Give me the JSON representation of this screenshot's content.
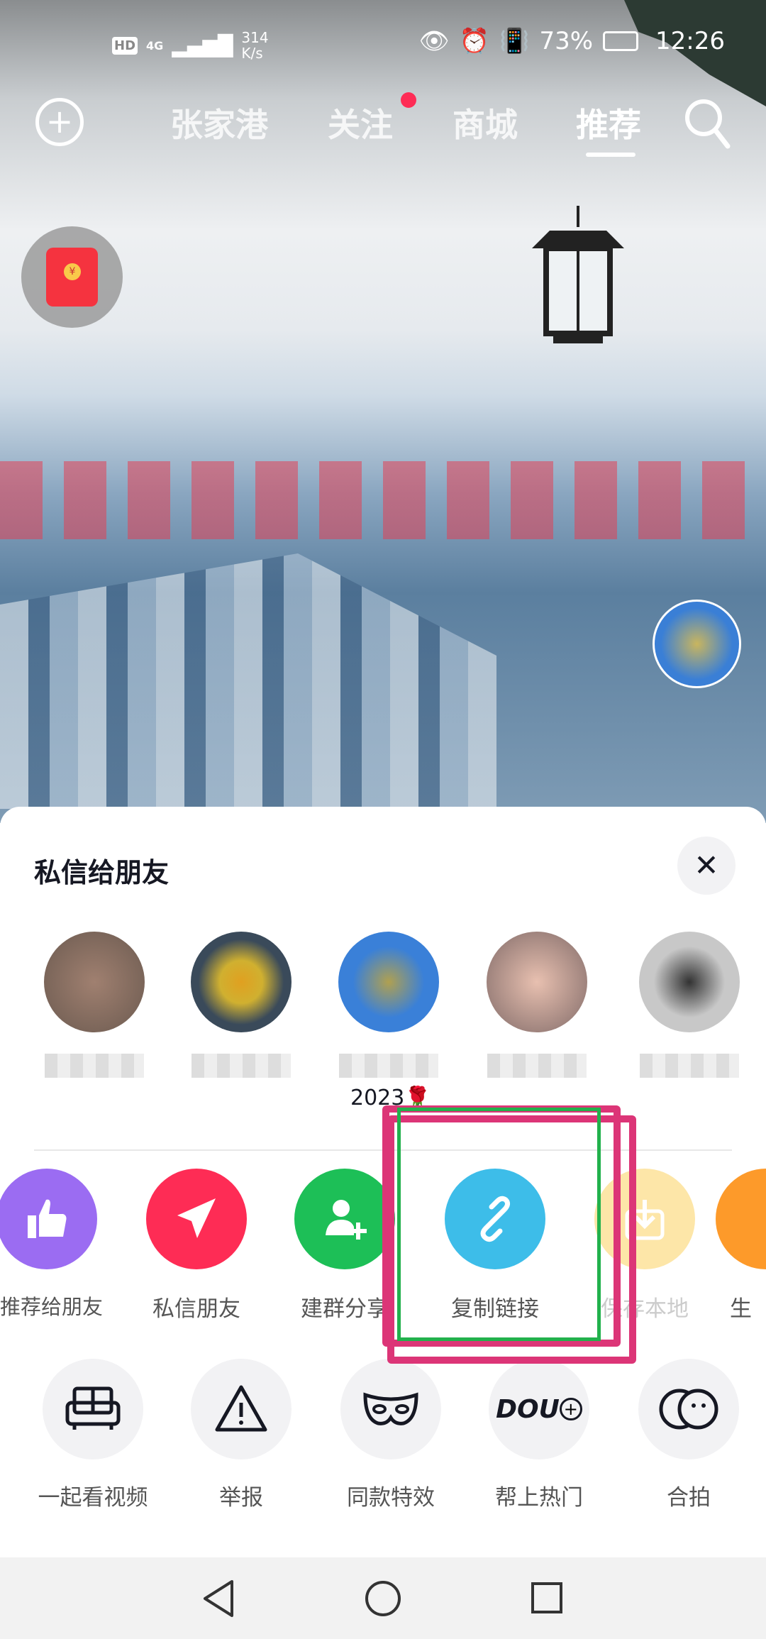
{
  "status_bar": {
    "hd": "HD",
    "network": "4G",
    "speed_value": "314",
    "speed_unit": "K/s",
    "battery": "73%",
    "time": "12:26"
  },
  "top_nav": {
    "tabs": [
      {
        "label": "张家港"
      },
      {
        "label": "关注",
        "badge": true
      },
      {
        "label": "商城"
      },
      {
        "label": "推荐",
        "active": true
      }
    ]
  },
  "share_sheet": {
    "title": "私信给朋友",
    "friends": [
      {
        "name": ""
      },
      {
        "name": ""
      },
      {
        "name": "",
        "extra": "2023🌹"
      },
      {
        "name": ""
      },
      {
        "name": ""
      }
    ],
    "share_row": [
      {
        "label": "推荐给朋友",
        "icon": "thumbs-up-icon",
        "color": "#9b6cf2"
      },
      {
        "label": "私信朋友",
        "icon": "send-icon",
        "color": "#fe2c55"
      },
      {
        "label": "建群分享",
        "icon": "group-add-icon",
        "color": "#1dbf57"
      },
      {
        "label": "复制链接",
        "icon": "link-icon",
        "color": "#3dbde9"
      },
      {
        "label": "保存本地",
        "icon": "download-icon",
        "color": "#fde6a8"
      },
      {
        "label": "生",
        "icon": "orange-icon",
        "color": "#fd9a2a"
      }
    ],
    "action_row": [
      {
        "label": "一起看视频",
        "icon": "sofa-icon"
      },
      {
        "label": "举报",
        "icon": "warning-icon"
      },
      {
        "label": "同款特效",
        "icon": "mask-icon"
      },
      {
        "label": "帮上热门",
        "icon": "dou-plus-icon",
        "text": "DOU"
      },
      {
        "label": "合拍",
        "icon": "duet-icon"
      }
    ]
  },
  "colors": {
    "accent": "#fe2c55",
    "annotation_outer": "#dc3577",
    "annotation_inner": "#22b14c"
  }
}
